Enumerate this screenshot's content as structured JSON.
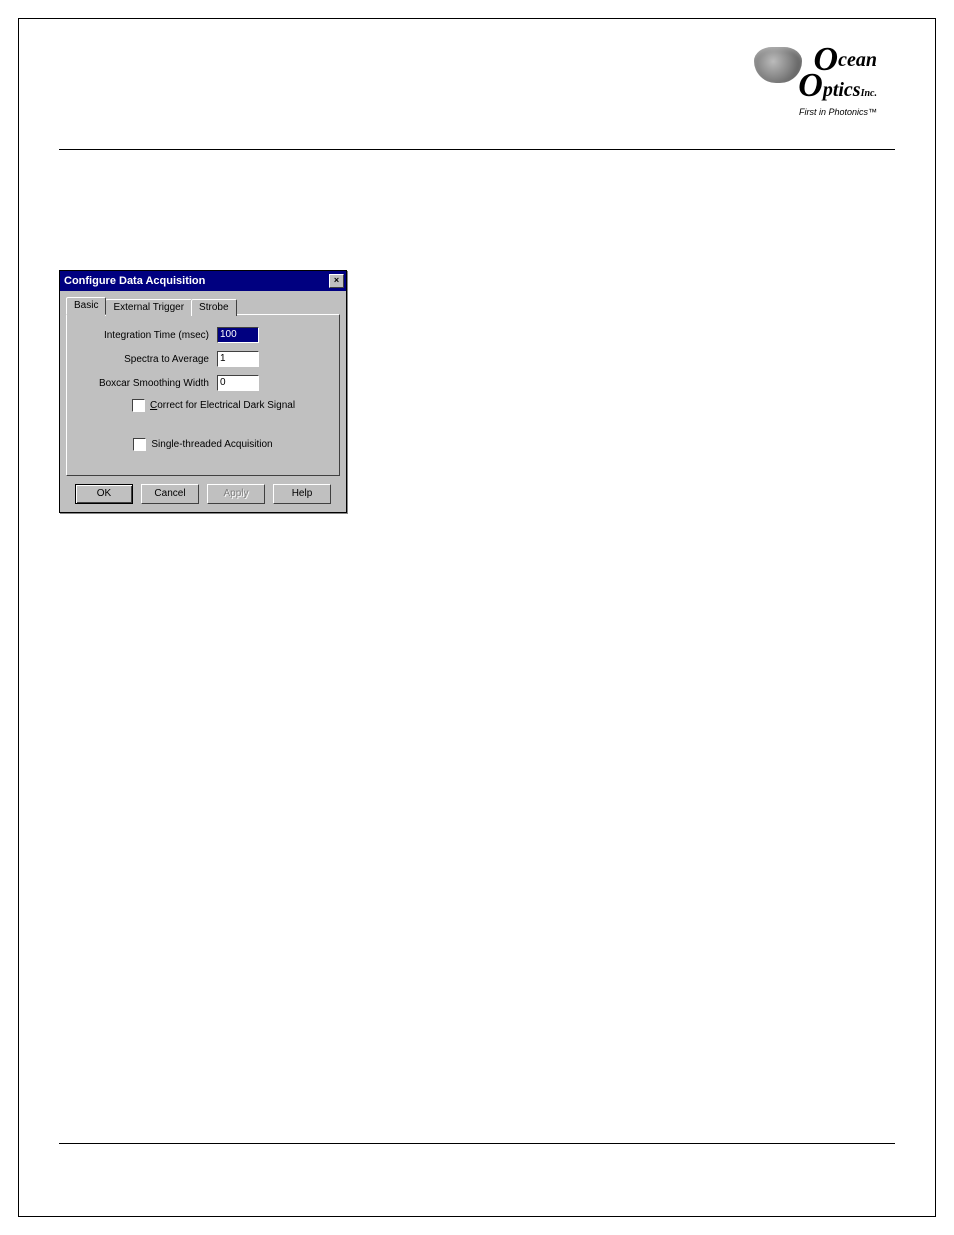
{
  "logo": {
    "line1": "cean",
    "line2": "ptics",
    "inc": "Inc.",
    "slogan": "First in Photonics™"
  },
  "dialog": {
    "title": "Configure Data Acquisition",
    "close": "×",
    "tabs": {
      "t0": "Basic",
      "t1": "External Trigger",
      "t2": "Strobe"
    },
    "fields": {
      "integration_label": "Integration Time (msec)",
      "integration_value": "100",
      "average_label": "Spectra to Average",
      "average_value": "1",
      "boxcar_label": "Boxcar Smoothing Width",
      "boxcar_value": "0",
      "correct_label_prefix": "C",
      "correct_label_rest": "orrect for Electrical Dark Signal",
      "singlethread_label": "Single-threaded Acquisition"
    },
    "buttons": {
      "ok": "OK",
      "cancel": "Cancel",
      "apply": "Apply",
      "help": "Help"
    }
  }
}
